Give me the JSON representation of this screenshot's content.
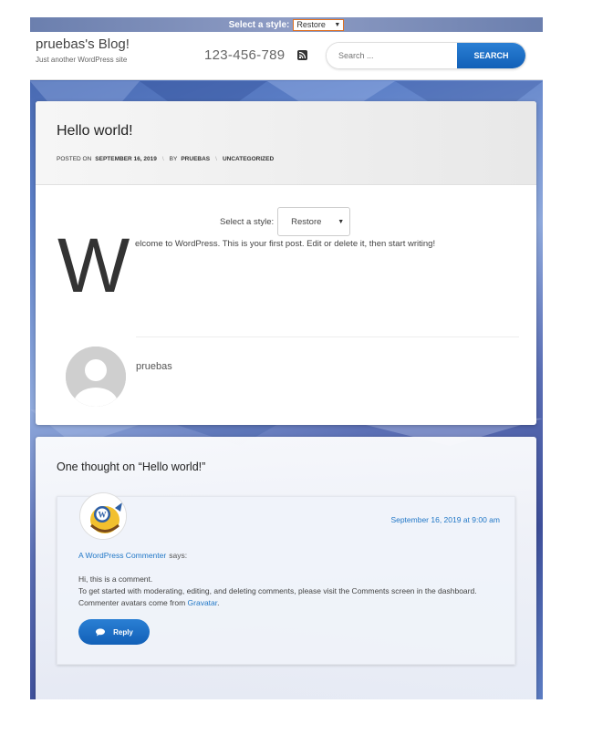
{
  "style_switcher": {
    "label": "Select a style:",
    "value": "Restore"
  },
  "header": {
    "site_title": "pruebas's Blog!",
    "tagline": "Just another WordPress site",
    "phone": "123-456-789",
    "rss_icon": "rss-icon",
    "search": {
      "placeholder": "Search ...",
      "button_label": "SEARCH"
    }
  },
  "post": {
    "title": "Hello world!",
    "meta": {
      "posted_on_label": "POSTED ON",
      "date": "SEPTEMBER 16, 2019",
      "by_label": "BY",
      "author": "PRUEBAS",
      "category": "UNCATEGORIZED"
    },
    "style_select": {
      "label": "Select a style:",
      "value": "Restore"
    },
    "dropcap": "W",
    "text": "elcome to WordPress. This is your first post. Edit or delete it, then start writing!",
    "author_box": {
      "name": "pruebas"
    }
  },
  "comments": {
    "title": "One thought on “Hello world!”",
    "items": [
      {
        "author": "A WordPress Commenter",
        "says": "says:",
        "date": "September 16, 2019 at 9:00 am",
        "line1": "Hi, this is a comment.",
        "line2": "To get started with moderating, editing, and deleting comments, please visit the Comments screen in the dashboard.",
        "line3_prefix": "Commenter avatars come from",
        "line3_link": "Gravatar",
        "line3_suffix": ".",
        "reply_label": "Reply"
      }
    ]
  },
  "colors": {
    "accent": "#1a6fcb",
    "link": "#2278c7",
    "background": "#4a66ad"
  }
}
